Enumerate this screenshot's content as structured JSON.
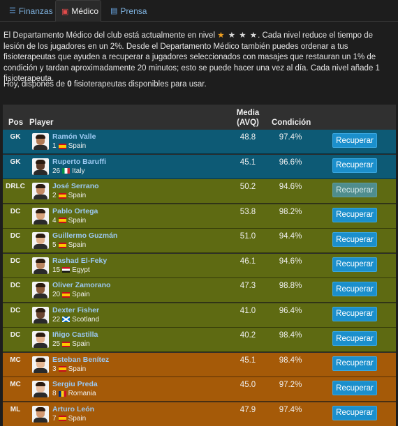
{
  "tabs": [
    {
      "label": "Finanzas",
      "icon": "finance-icon"
    },
    {
      "label": "Médico",
      "icon": "medical-kit-icon",
      "active": true
    },
    {
      "label": "Prensa",
      "icon": "newspaper-icon"
    }
  ],
  "intro": {
    "text_before": "El Departamento Médico del club está actualmente en nivel",
    "stars_filled": 1,
    "stars_total": 4,
    "text_after": ". Cada nivel reduce el tiempo de lesión de los jugadores en un 2%. Desde el Departamento Médico también puedes ordenar a tus fisioterapeutas que ayuden a recuperar a jugadores seleccionados con masajes que restauran un 1% de condición y tardan aproximadamente 20 minutos; esto se puede hacer una vez al día. Cada nivel añade 1 fisioterapeuta."
  },
  "available": {
    "before": "Hoy, dispones de",
    "count": "0",
    "after": "fisioterapeutas disponibles para usar."
  },
  "table": {
    "headers": {
      "pos": "Pos",
      "player": "Player",
      "media_line1": "Media",
      "media_line2": "(AVQ)",
      "condition": "Condición"
    },
    "rows": [
      {
        "pos": "GK",
        "name": "Ramón Valle",
        "number": "1",
        "country": "Spain",
        "flag": "es",
        "avg": "48.8",
        "cond": "97.4%",
        "button": "Recuperar",
        "group": "gk",
        "disabled": false,
        "skin": "#b07a55"
      },
      {
        "pos": "GK",
        "name": "Ruperto Baruffi",
        "number": "26",
        "country": "Italy",
        "flag": "it",
        "avg": "45.1",
        "cond": "96.6%",
        "button": "Recuperar",
        "group": "gk",
        "disabled": false,
        "skin": "#5a3a28"
      },
      {
        "pos": "DRLC",
        "name": "José Serrano",
        "number": "2",
        "country": "Spain",
        "flag": "es",
        "avg": "50.2",
        "cond": "94.6%",
        "button": "Recuperar",
        "group": "df",
        "disabled": true,
        "skin": "#c48a63"
      },
      {
        "pos": "DC",
        "name": "Pablo Ortega",
        "number": "4",
        "country": "Spain",
        "flag": "es",
        "avg": "53.8",
        "cond": "98.2%",
        "button": "Recuperar",
        "group": "df",
        "disabled": false,
        "skin": "#d8a27a"
      },
      {
        "pos": "DC",
        "name": "Guillermo Guzmán",
        "number": "5",
        "country": "Spain",
        "flag": "es",
        "avg": "51.0",
        "cond": "94.4%",
        "button": "Recuperar",
        "group": "df",
        "disabled": false,
        "skin": "#e0b08a"
      },
      {
        "pos": "DC",
        "name": "Rashad El-Feky",
        "number": "15",
        "country": "Egypt",
        "flag": "eg",
        "avg": "46.1",
        "cond": "94.6%",
        "button": "Recuperar",
        "group": "df",
        "disabled": false,
        "skin": "#b98560"
      },
      {
        "pos": "DC",
        "name": "Oliver Zamorano",
        "number": "20",
        "country": "Spain",
        "flag": "es",
        "avg": "47.3",
        "cond": "98.8%",
        "button": "Recuperar",
        "group": "df",
        "disabled": false,
        "skin": "#8a5a3a"
      },
      {
        "pos": "DC",
        "name": "Dexter Fisher",
        "number": "22",
        "country": "Scotland",
        "flag": "sc",
        "avg": "41.0",
        "cond": "96.4%",
        "button": "Recuperar",
        "group": "df",
        "disabled": false,
        "skin": "#6a4530"
      },
      {
        "pos": "DC",
        "name": "Iñigo Castilla",
        "number": "25",
        "country": "Spain",
        "flag": "es",
        "avg": "40.2",
        "cond": "98.4%",
        "button": "Recuperar",
        "group": "df",
        "disabled": false,
        "skin": "#e2b18c"
      },
      {
        "pos": "MC",
        "name": "Esteban Benítez",
        "number": "3",
        "country": "Spain",
        "flag": "es",
        "avg": "45.1",
        "cond": "98.4%",
        "button": "Recuperar",
        "group": "mc",
        "disabled": false,
        "skin": "#e6b996"
      },
      {
        "pos": "MC",
        "name": "Sergiu Preda",
        "number": "8",
        "country": "Romania",
        "flag": "ro",
        "avg": "45.0",
        "cond": "97.2%",
        "button": "Recuperar",
        "group": "mc",
        "disabled": false,
        "skin": "#e8bea0"
      },
      {
        "pos": "ML",
        "name": "Arturo León",
        "number": "7",
        "country": "Spain",
        "flag": "es",
        "avg": "47.9",
        "cond": "97.4%",
        "button": "Recuperar",
        "group": "mc",
        "disabled": false,
        "skin": "#d49a72"
      }
    ]
  }
}
